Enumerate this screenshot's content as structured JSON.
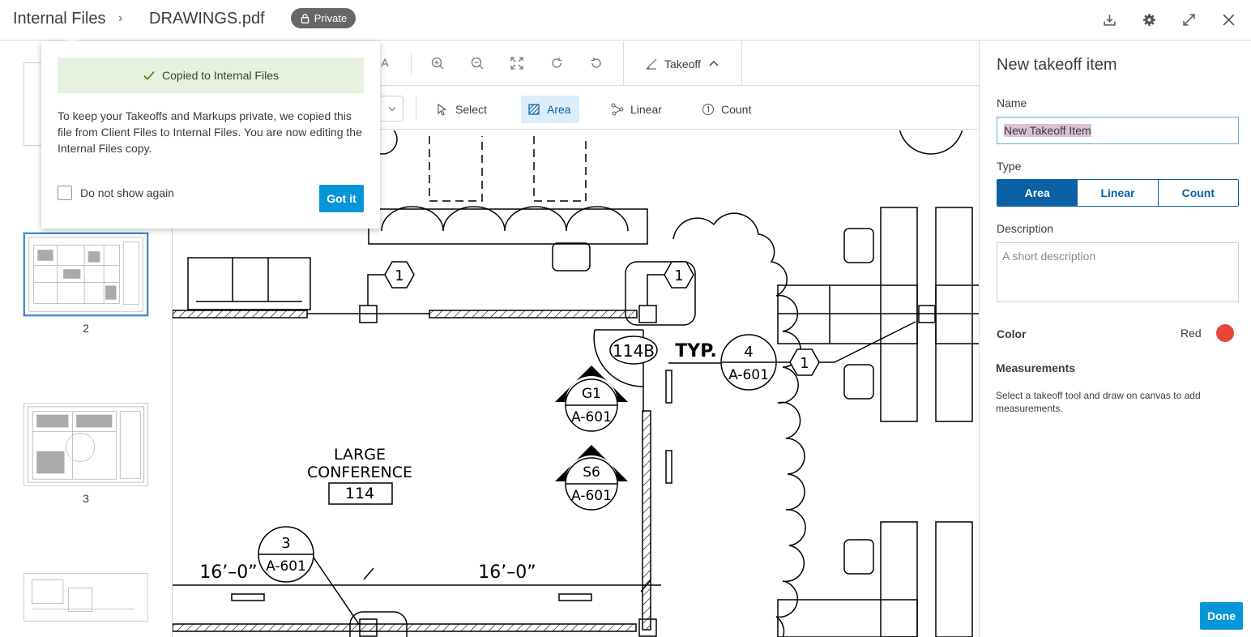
{
  "header": {
    "breadcrumb": "Internal Files",
    "breadcrumb_sep": "›",
    "filename": "DRAWINGS.pdf",
    "privacy_badge": "Private",
    "icons": [
      "download-icon",
      "gear-icon",
      "expand-icon",
      "close-icon"
    ]
  },
  "thumbnails": [
    {
      "page": "",
      "selected": false
    },
    {
      "page": "2",
      "selected": true
    },
    {
      "page": "3",
      "selected": false
    },
    {
      "page": "",
      "selected": false
    }
  ],
  "toolbar": {
    "icons": [
      "text-icon",
      "zoom-in-icon",
      "zoom-out-icon",
      "fit-icon",
      "rotate-cw-icon",
      "rotate-ccw-icon"
    ],
    "takeoff_tab": "Takeoff",
    "tools": {
      "select": "Select",
      "area": "Area",
      "linear": "Linear",
      "count": "Count"
    }
  },
  "drawing": {
    "tags": [
      "1",
      "1",
      "1",
      "114B",
      "TYP.",
      "4",
      "A-601",
      "G1",
      "A-601",
      "S6",
      "A-601",
      "3",
      "A-601"
    ],
    "room_name_line1": "LARGE",
    "room_name_line2": "CONFERENCE",
    "room_number": "114",
    "dim1": "16’–0”",
    "dim2": "16’–0”"
  },
  "popup": {
    "toast": "Copied to Internal Files",
    "message": "To keep your Takeoffs and Markups private, we copied this file from Client Files to Internal Files. You are now editing the Internal Files copy.",
    "checkbox_label": "Do not show again",
    "button": "Got it"
  },
  "panel": {
    "title": "New takeoff item",
    "name_label": "Name",
    "name_value": "New Takeoff Item",
    "type_label": "Type",
    "types": [
      "Area",
      "Linear",
      "Count"
    ],
    "selected_type": "Area",
    "description_label": "Description",
    "description_placeholder": "A short description",
    "color_label": "Color",
    "color_value": "Red",
    "color_hex": "#e8453c",
    "measurements_label": "Measurements",
    "measurements_note": "Select a takeoff tool and draw on canvas to add measurements.",
    "done_button": "Done"
  },
  "colors": {
    "accent": "#0696d7",
    "active_type": "#0b5fa5",
    "toast_bg": "#e7f1e0"
  }
}
